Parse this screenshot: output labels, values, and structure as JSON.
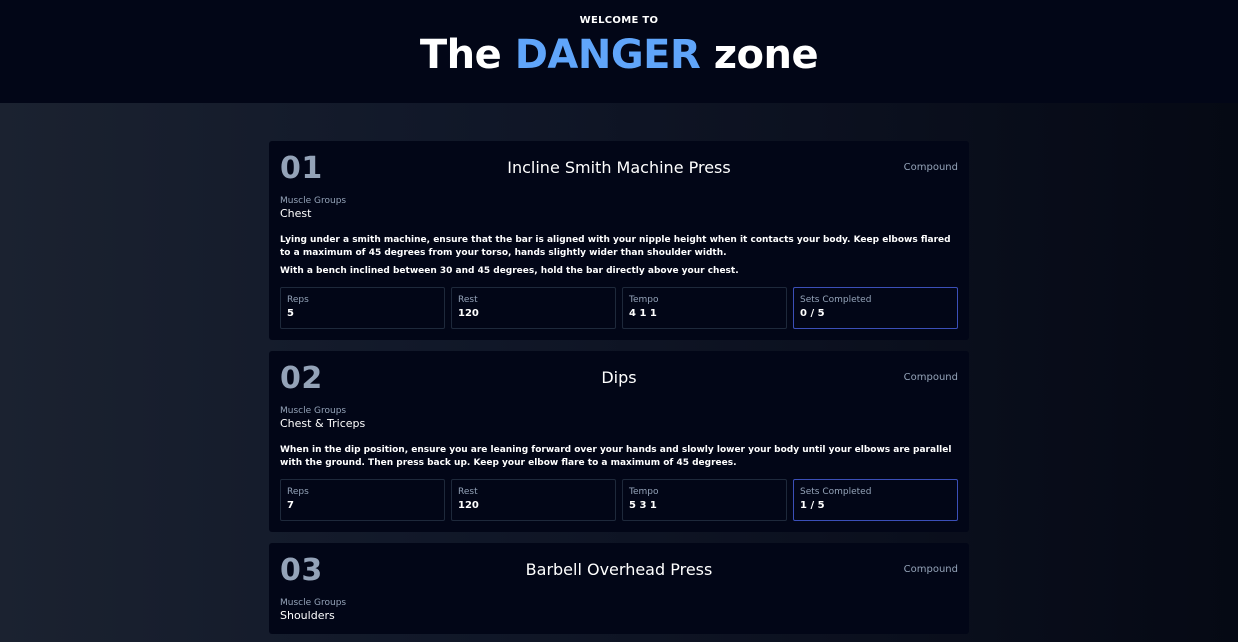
{
  "header": {
    "welcome": "WELCOME TO",
    "title_prefix": "The",
    "title_highlight": "DANGER",
    "title_suffix": "zone"
  },
  "colors": {
    "accent": "#60a5fa",
    "card_bg": "#020617",
    "muted": "#94a3b8",
    "active_border": "#3b4fb8"
  },
  "exercises": [
    {
      "number": "01",
      "name": "Incline Smith Machine Press",
      "type": "Compound",
      "muscle_groups_label": "Muscle Groups",
      "muscle_groups": "Chest",
      "description": [
        "Lying under a smith machine, ensure that the bar is aligned with your nipple height when it contacts your body. Keep elbows flared to a maximum of 45 degrees from your torso, hands slightly wider than shoulder width.",
        "With a bench inclined between 30 and 45 degrees, hold the bar directly above your chest."
      ],
      "stats": {
        "reps_label": "Reps",
        "reps": "5",
        "rest_label": "Rest",
        "rest": "120",
        "tempo_label": "Tempo",
        "tempo": "4 1 1",
        "sets_label": "Sets Completed",
        "sets": "0 / 5"
      }
    },
    {
      "number": "02",
      "name": "Dips",
      "type": "Compound",
      "muscle_groups_label": "Muscle Groups",
      "muscle_groups": "Chest & Triceps",
      "description": [
        "When in the dip position, ensure you are leaning forward over your hands and slowly lower your body until your elbows are parallel with the ground. Then press back up. Keep your elbow flare to a maximum of 45 degrees."
      ],
      "stats": {
        "reps_label": "Reps",
        "reps": "7",
        "rest_label": "Rest",
        "rest": "120",
        "tempo_label": "Tempo",
        "tempo": "5 3 1",
        "sets_label": "Sets Completed",
        "sets": "1 / 5"
      }
    },
    {
      "number": "03",
      "name": "Barbell Overhead Press",
      "type": "Compound",
      "muscle_groups_label": "Muscle Groups",
      "muscle_groups": "Shoulders"
    }
  ]
}
